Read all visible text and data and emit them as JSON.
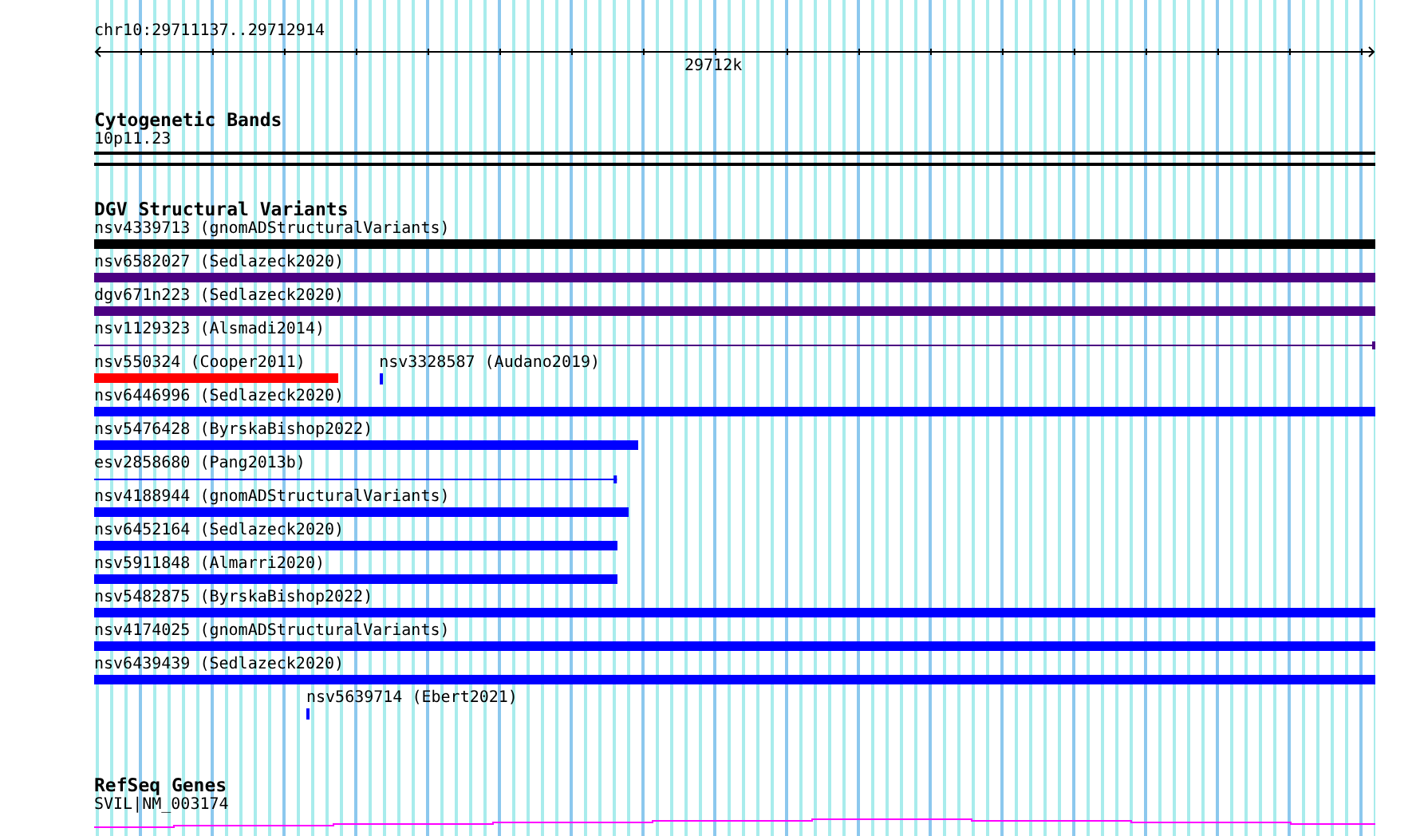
{
  "location": "chr10:29711137..29712914",
  "ruler": {
    "tick_label": "29712k"
  },
  "tracks": [
    {
      "kind": "bands",
      "title": "Cytogenetic Bands",
      "label": "10p11.23"
    },
    {
      "kind": "variants",
      "title": "DGV Structural Variants",
      "rows": [
        {
          "features": [
            {
              "label": "nsv4339713 (gnomADStructuralVariants)",
              "color": "#000000",
              "kind": "bar",
              "level": 1
            }
          ]
        },
        {
          "features": [
            {
              "label": "nsv6582027 (Sedlazeck2020)",
              "color": "#4b0082",
              "kind": "bar",
              "level": 1
            }
          ]
        },
        {
          "features": [
            {
              "label": "dgv671n223 (Sedlazeck2020)",
              "color": "#4b0082",
              "kind": "bar",
              "level": 1
            }
          ]
        },
        {
          "features": [
            {
              "label": "nsv1129323 (Alsmadi2014)",
              "color": "#4b0082",
              "kind": "line",
              "level": 1
            }
          ]
        },
        {
          "features": [
            {
              "label": "nsv550324 (Cooper2011)",
              "color": "#ff0000",
              "kind": "bar",
              "level": 0.19
            },
            {
              "label": "nsv3328587 (Audano2019)",
              "color": "#0000ff",
              "kind": "tick"
            }
          ]
        },
        {
          "features": [
            {
              "label": "nsv6446996 (Sedlazeck2020)",
              "color": "#0000ff",
              "kind": "bar",
              "level": 1
            }
          ]
        },
        {
          "features": [
            {
              "label": "nsv5476428 (ByrskaBishop2022)",
              "color": "#0000ff",
              "kind": "bar",
              "level": 0.425
            }
          ]
        },
        {
          "features": [
            {
              "label": "esv2858680 (Pang2013b)",
              "color": "#0000ff",
              "kind": "line",
              "level": 0.408
            }
          ]
        },
        {
          "features": [
            {
              "label": "nsv4188944 (gnomADStructuralVariants)",
              "color": "#0000ff",
              "kind": "bar",
              "level": 0.417
            }
          ]
        },
        {
          "features": [
            {
              "label": "nsv6452164 (Sedlazeck2020)",
              "color": "#0000ff",
              "kind": "bar",
              "level": 0.408
            }
          ]
        },
        {
          "features": [
            {
              "label": "nsv5911848 (Almarri2020)",
              "color": "#0000ff",
              "kind": "bar",
              "level": 0.408
            }
          ]
        },
        {
          "features": [
            {
              "label": "nsv5482875 (ByrskaBishop2022)",
              "color": "#0000ff",
              "kind": "bar",
              "level": 1
            }
          ]
        },
        {
          "features": [
            {
              "label": "nsv4174025 (gnomADStructuralVariants)",
              "color": "#0000ff",
              "kind": "bar",
              "level": 1
            }
          ]
        },
        {
          "features": [
            {
              "label": "nsv6439439 (Sedlazeck2020)",
              "color": "#0000ff",
              "kind": "bar",
              "level": 1
            }
          ]
        },
        {
          "features": [
            {
              "label": "nsv5639714 (Ebert2021)",
              "color": "#0000ff",
              "kind": "tick"
            }
          ]
        }
      ]
    },
    {
      "kind": "genes",
      "title": "RefSeq Genes",
      "label": "SVIL|NM_003174"
    }
  ]
}
